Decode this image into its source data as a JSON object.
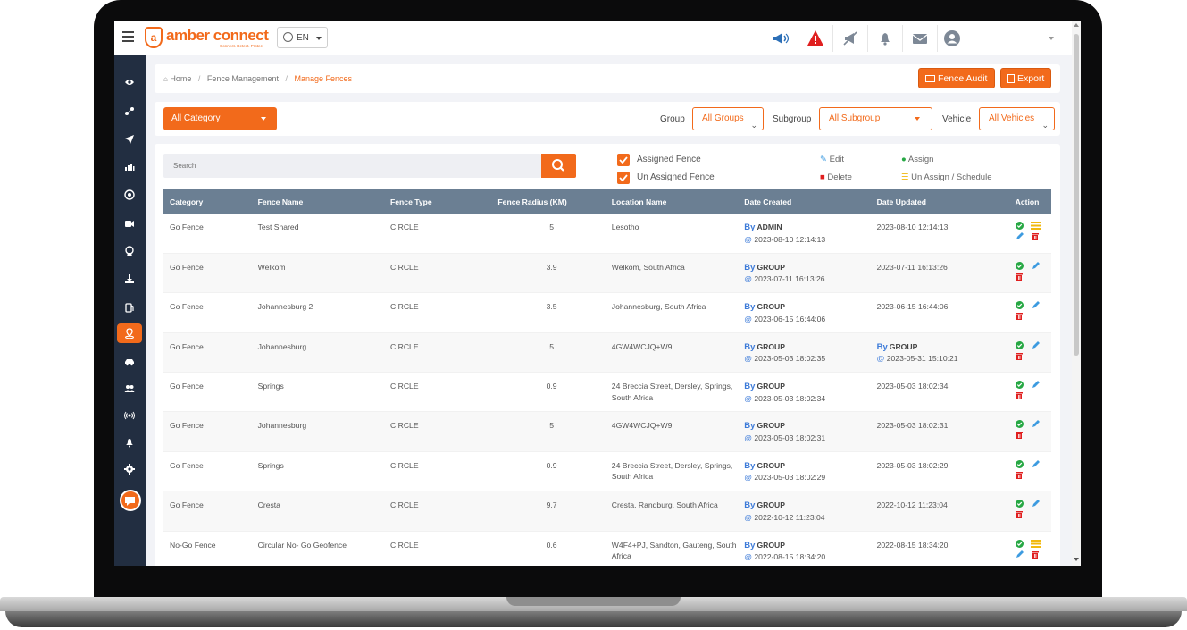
{
  "brand": {
    "name": "amber connect",
    "tagline": "Connect. Detect. Protect",
    "accent": "#f26a1b",
    "sidebar_bg": "#222e41",
    "table_header_bg": "#6b7f93"
  },
  "language": {
    "current": "EN"
  },
  "topbar_icons": [
    "megaphone-icon",
    "alert-triangle-icon",
    "muted-megaphone-icon",
    "bell-icon",
    "mail-icon",
    "user-icon"
  ],
  "sidebar": {
    "items": [
      "eye-icon",
      "route-icon",
      "navigation-icon",
      "chart-icon",
      "target-icon",
      "camera-icon",
      "badge-icon",
      "download-icon",
      "fuel-icon",
      "geofence-icon",
      "car-icon",
      "users-icon",
      "signal-icon",
      "bell-icon",
      "gear-icon"
    ],
    "active_index": 9
  },
  "breadcrumb": {
    "home": "Home",
    "parent": "Fence Management",
    "current": "Manage Fences"
  },
  "actions": {
    "fence_audit": "Fence Audit",
    "export": "Export"
  },
  "filters": {
    "category": "All Category",
    "group_label": "Group",
    "group_value": "All Groups",
    "subgroup_label": "Subgroup",
    "subgroup_value": "All Subgroup",
    "vehicle_label": "Vehicle",
    "vehicle_value": "All Vehicles"
  },
  "search": {
    "placeholder": "Search"
  },
  "checkboxes": {
    "assigned": "Assigned Fence",
    "unassigned": "Un Assigned Fence"
  },
  "legend": {
    "edit": "Edit",
    "delete": "Delete",
    "assign": "Assign",
    "unassign": "Un Assign / Schedule"
  },
  "table": {
    "columns": [
      "Category",
      "Fence Name",
      "Fence Type",
      "Fence Radius (KM)",
      "Location Name",
      "Date Created",
      "Date Updated",
      "Action"
    ],
    "by_prefix": "By",
    "at_prefix": "@",
    "rows": [
      {
        "category": "Go Fence",
        "name": "Test Shared",
        "type": "CIRCLE",
        "radius": "5",
        "location": "Lesotho",
        "created_by": "ADMIN",
        "created_at": "2023-08-10 12:14:13",
        "updated_by": "",
        "updated_at": "2023-08-10 12:14:13",
        "actions": "full"
      },
      {
        "category": "Go Fence",
        "name": "Welkom",
        "type": "CIRCLE",
        "radius": "3.9",
        "location": "Welkom, South Africa",
        "created_by": "GROUP",
        "created_at": "2023-07-11 16:13:26",
        "updated_by": "",
        "updated_at": "2023-07-11 16:13:26",
        "actions": "basic"
      },
      {
        "category": "Go Fence",
        "name": "Johannesburg 2",
        "type": "CIRCLE",
        "radius": "3.5",
        "location": "Johannesburg, South Africa",
        "created_by": "GROUP",
        "created_at": "2023-06-15 16:44:06",
        "updated_by": "",
        "updated_at": "2023-06-15 16:44:06",
        "actions": "basic"
      },
      {
        "category": "Go Fence",
        "name": "Johannesburg",
        "type": "CIRCLE",
        "radius": "5",
        "location": "4GW4WCJQ+W9",
        "created_by": "GROUP",
        "created_at": "2023-05-03 18:02:35",
        "updated_by": "GROUP",
        "updated_at": "2023-05-31 15:10:21",
        "actions": "basic"
      },
      {
        "category": "Go Fence",
        "name": "Springs",
        "type": "CIRCLE",
        "radius": "0.9",
        "location": "24 Breccia Street, Dersley, Springs, South Africa",
        "created_by": "GROUP",
        "created_at": "2023-05-03 18:02:34",
        "updated_by": "",
        "updated_at": "2023-05-03 18:02:34",
        "actions": "basic"
      },
      {
        "category": "Go Fence",
        "name": "Johannesburg",
        "type": "CIRCLE",
        "radius": "5",
        "location": "4GW4WCJQ+W9",
        "created_by": "GROUP",
        "created_at": "2023-05-03 18:02:31",
        "updated_by": "",
        "updated_at": "2023-05-03 18:02:31",
        "actions": "basic"
      },
      {
        "category": "Go Fence",
        "name": "Springs",
        "type": "CIRCLE",
        "radius": "0.9",
        "location": "24 Breccia Street, Dersley, Springs, South Africa",
        "created_by": "GROUP",
        "created_at": "2023-05-03 18:02:29",
        "updated_by": "",
        "updated_at": "2023-05-03 18:02:29",
        "actions": "basic"
      },
      {
        "category": "Go Fence",
        "name": "Cresta",
        "type": "CIRCLE",
        "radius": "9.7",
        "location": "Cresta, Randburg, South Africa",
        "created_by": "GROUP",
        "created_at": "2022-10-12 11:23:04",
        "updated_by": "",
        "updated_at": "2022-10-12 11:23:04",
        "actions": "basic"
      },
      {
        "category": "No-Go Fence",
        "name": "Circular No- Go Geofence",
        "type": "CIRCLE",
        "radius": "0.6",
        "location": "W4F4+PJ, Sandton, Gauteng, South Africa",
        "created_by": "GROUP",
        "created_at": "2022-08-15 18:34:20",
        "updated_by": "",
        "updated_at": "2022-08-15 18:34:20",
        "actions": "full"
      }
    ]
  }
}
